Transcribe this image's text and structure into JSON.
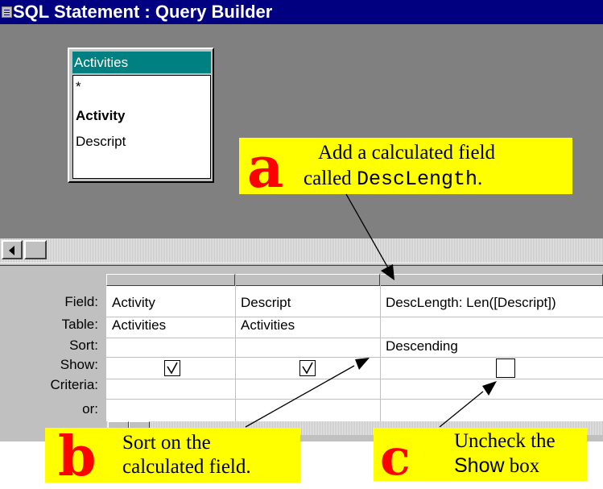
{
  "window": {
    "title": "SQL Statement : Query Builder"
  },
  "table_box": {
    "title": "Activities",
    "fields": [
      "*",
      "Activity",
      "Descript"
    ]
  },
  "grid": {
    "row_labels": [
      "Field:",
      "Table:",
      "Sort:",
      "Show:",
      "Criteria:",
      "or:"
    ],
    "columns": [
      {
        "field": "Activity",
        "table": "Activities",
        "sort": "",
        "show": true
      },
      {
        "field": "Descript",
        "table": "Activities",
        "sort": "",
        "show": true
      },
      {
        "field": "DescLength: Len([Descript])",
        "table": "",
        "sort": "Descending",
        "show": false
      }
    ]
  },
  "callouts": {
    "a": {
      "letter": "a",
      "line1": "Add a calculated field",
      "line2_prefix": "called ",
      "line2_code": "DescLength",
      "line2_suffix": "."
    },
    "b": {
      "letter": "b",
      "line1": "Sort on the",
      "line2": "calculated field."
    },
    "c": {
      "letter": "c",
      "line1": "Uncheck the",
      "line2_sans": "Show",
      "line2_suffix": " box"
    }
  },
  "colors": {
    "titlebar": "#000080",
    "table_title": "#008080",
    "callout_bg": "#ffff00",
    "callout_letter": "#ff0000"
  }
}
